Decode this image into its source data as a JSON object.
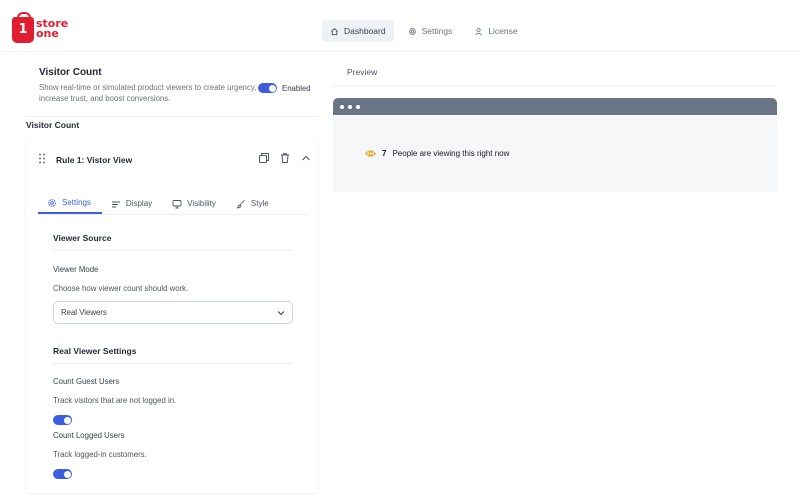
{
  "brand": {
    "logo_mark": "1",
    "line1": "store",
    "line2": "one",
    "color": "#e11d2e"
  },
  "nav": [
    {
      "label": "Dashboard",
      "icon": "home-icon",
      "active": true
    },
    {
      "label": "Settings",
      "icon": "gear-icon",
      "active": false
    },
    {
      "label": "License",
      "icon": "user-icon",
      "active": false
    }
  ],
  "visitor_count": {
    "title": "Visitor Count",
    "description": "Show real-time or simulated product viewers to create urgency, increase trust, and boost conversions.",
    "toggle_label": "Enabled",
    "enabled": true
  },
  "section_label": "Visitor Count",
  "rule": {
    "title": "Rule 1: Vistor View",
    "tabs": [
      {
        "label": "Settings",
        "icon": "gear-icon",
        "active": true
      },
      {
        "label": "Display",
        "icon": "sliders-icon",
        "active": false
      },
      {
        "label": "Visibility",
        "icon": "monitor-icon",
        "active": false
      },
      {
        "label": "Style",
        "icon": "brush-icon",
        "active": false
      }
    ],
    "viewer_source": {
      "heading": "Viewer Source",
      "mode_label": "Viewer Mode",
      "mode_help": "Choose how viewer count should work.",
      "mode_value": "Real Viewers"
    },
    "real_viewer_settings": {
      "heading": "Real Viewer Settings",
      "guest_label": "Count Guest Users",
      "guest_help": "Track visitors that are not logged in.",
      "guest_enabled": true,
      "logged_label": "Count Logged Users",
      "logged_help": "Track logged-in customers.",
      "logged_enabled": true
    }
  },
  "preview": {
    "label": "Preview",
    "count": "7",
    "message": "People are viewing this right now",
    "eye_color": "#d9a21b"
  },
  "colors": {
    "accent": "#3d5ee0",
    "browser_bar": "#6b7588"
  }
}
